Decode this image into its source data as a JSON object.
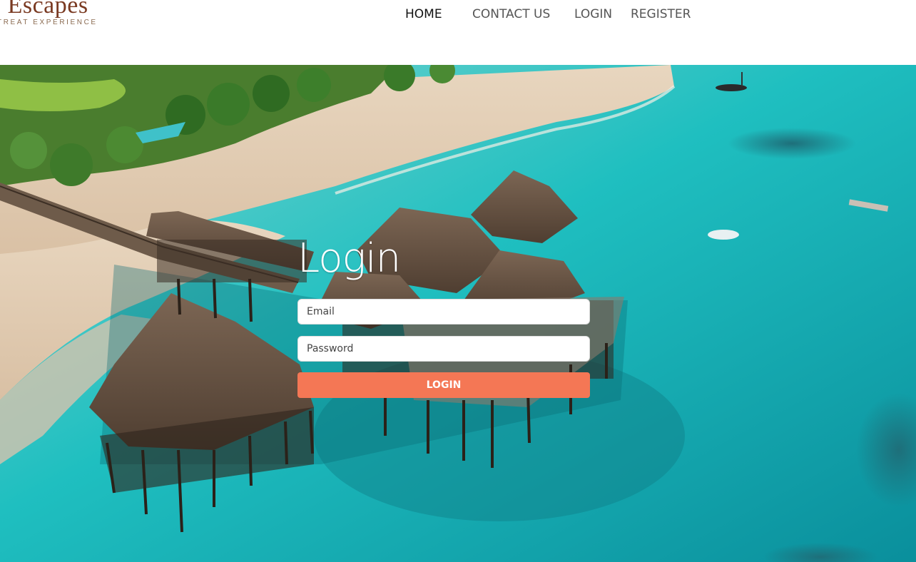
{
  "brand": {
    "title": "e Escapes",
    "tagline": "TREAT EXPERIENCE"
  },
  "nav": {
    "items": [
      {
        "label": "HOME",
        "active": true
      },
      {
        "label": "CONTACT US",
        "active": false
      },
      {
        "label": "LOGIN",
        "active": false
      },
      {
        "label": "REGISTER",
        "active": false
      }
    ]
  },
  "login": {
    "title": "Login",
    "email_placeholder": "Email",
    "password_placeholder": "Password",
    "button_label": "LOGIN",
    "button_color": "#f47755"
  },
  "colors": {
    "ocean": "#19b3b5",
    "sand": "#e3cdb4",
    "thatch": "#6b5646",
    "palm": "#3f7a2a"
  }
}
